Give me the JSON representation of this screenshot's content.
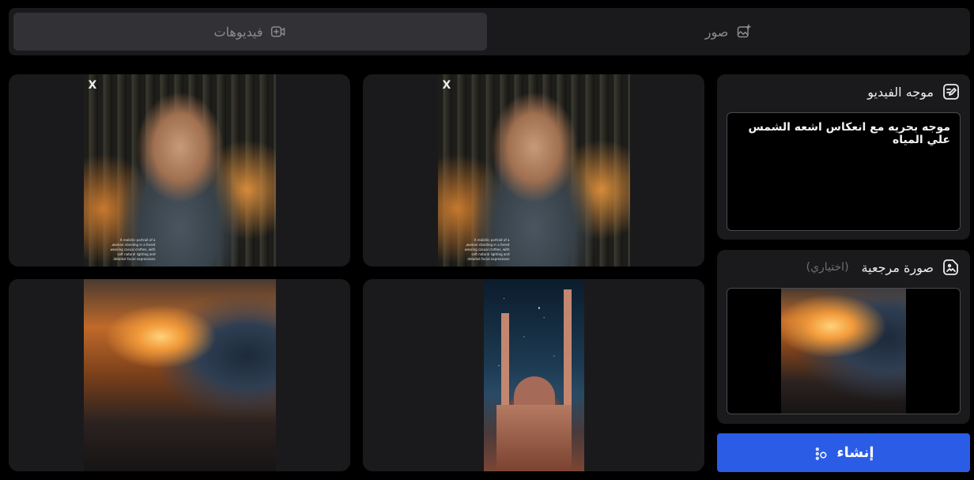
{
  "tabs": {
    "videos_label": "فيديوهات",
    "images_label": "صور"
  },
  "prompt_panel": {
    "title": "موجه الفيديو",
    "value": "موجه بحريه مع انعكاس اشعه الشمس علي المياه"
  },
  "reference_panel": {
    "title": "صورة مرجعية",
    "optional": "(اختياري)"
  },
  "create_button": {
    "label": "إنشاء"
  },
  "gallery": {
    "card1_caption_line1": "A realistic portrait of a",
    "card1_caption_line2": "woman standing in a forest,",
    "card1_caption_line3": "wearing casual clothes, with",
    "card1_caption_line4": "soft natural lighting and",
    "card1_caption_line5": "detailed facial expressions",
    "card1_brand": "X"
  },
  "colors": {
    "accent": "#2b5ce6",
    "panel": "#1a1a1c",
    "background": "#000000"
  }
}
